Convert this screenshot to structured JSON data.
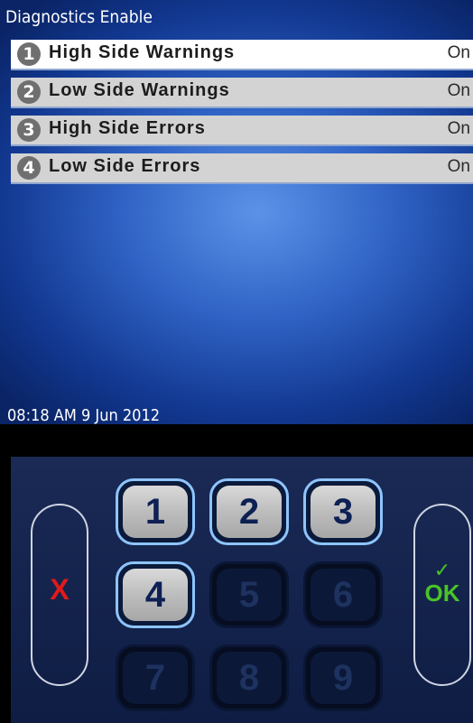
{
  "header": {
    "title": "Diagnostics Enable"
  },
  "menu": {
    "items": [
      {
        "num": "1",
        "label": "High Side Warnings",
        "value": "On",
        "selected": true
      },
      {
        "num": "2",
        "label": "Low Side Warnings",
        "value": "On",
        "selected": false
      },
      {
        "num": "3",
        "label": "High Side Errors",
        "value": "On",
        "selected": false
      },
      {
        "num": "4",
        "label": "Low Side Errors",
        "value": "On",
        "selected": false
      }
    ]
  },
  "status": {
    "datetime": "08:18 AM 9 Jun 2012"
  },
  "keypad": {
    "cancel_label": "X",
    "ok_label": "OK",
    "keys": [
      {
        "label": "1",
        "enabled": true
      },
      {
        "label": "2",
        "enabled": true
      },
      {
        "label": "3",
        "enabled": true
      },
      {
        "label": "4",
        "enabled": true
      },
      {
        "label": "5",
        "enabled": false
      },
      {
        "label": "6",
        "enabled": false
      },
      {
        "label": "7",
        "enabled": false
      },
      {
        "label": "8",
        "enabled": false
      },
      {
        "label": "9",
        "enabled": false
      }
    ]
  },
  "colors": {
    "cancel": "#e21a1a",
    "ok": "#49c427",
    "key_text": "#0e2054",
    "selection": "#ffffff",
    "row": "#d3d3d3"
  },
  "icons": {
    "ok_check": "checkmark-icon"
  }
}
